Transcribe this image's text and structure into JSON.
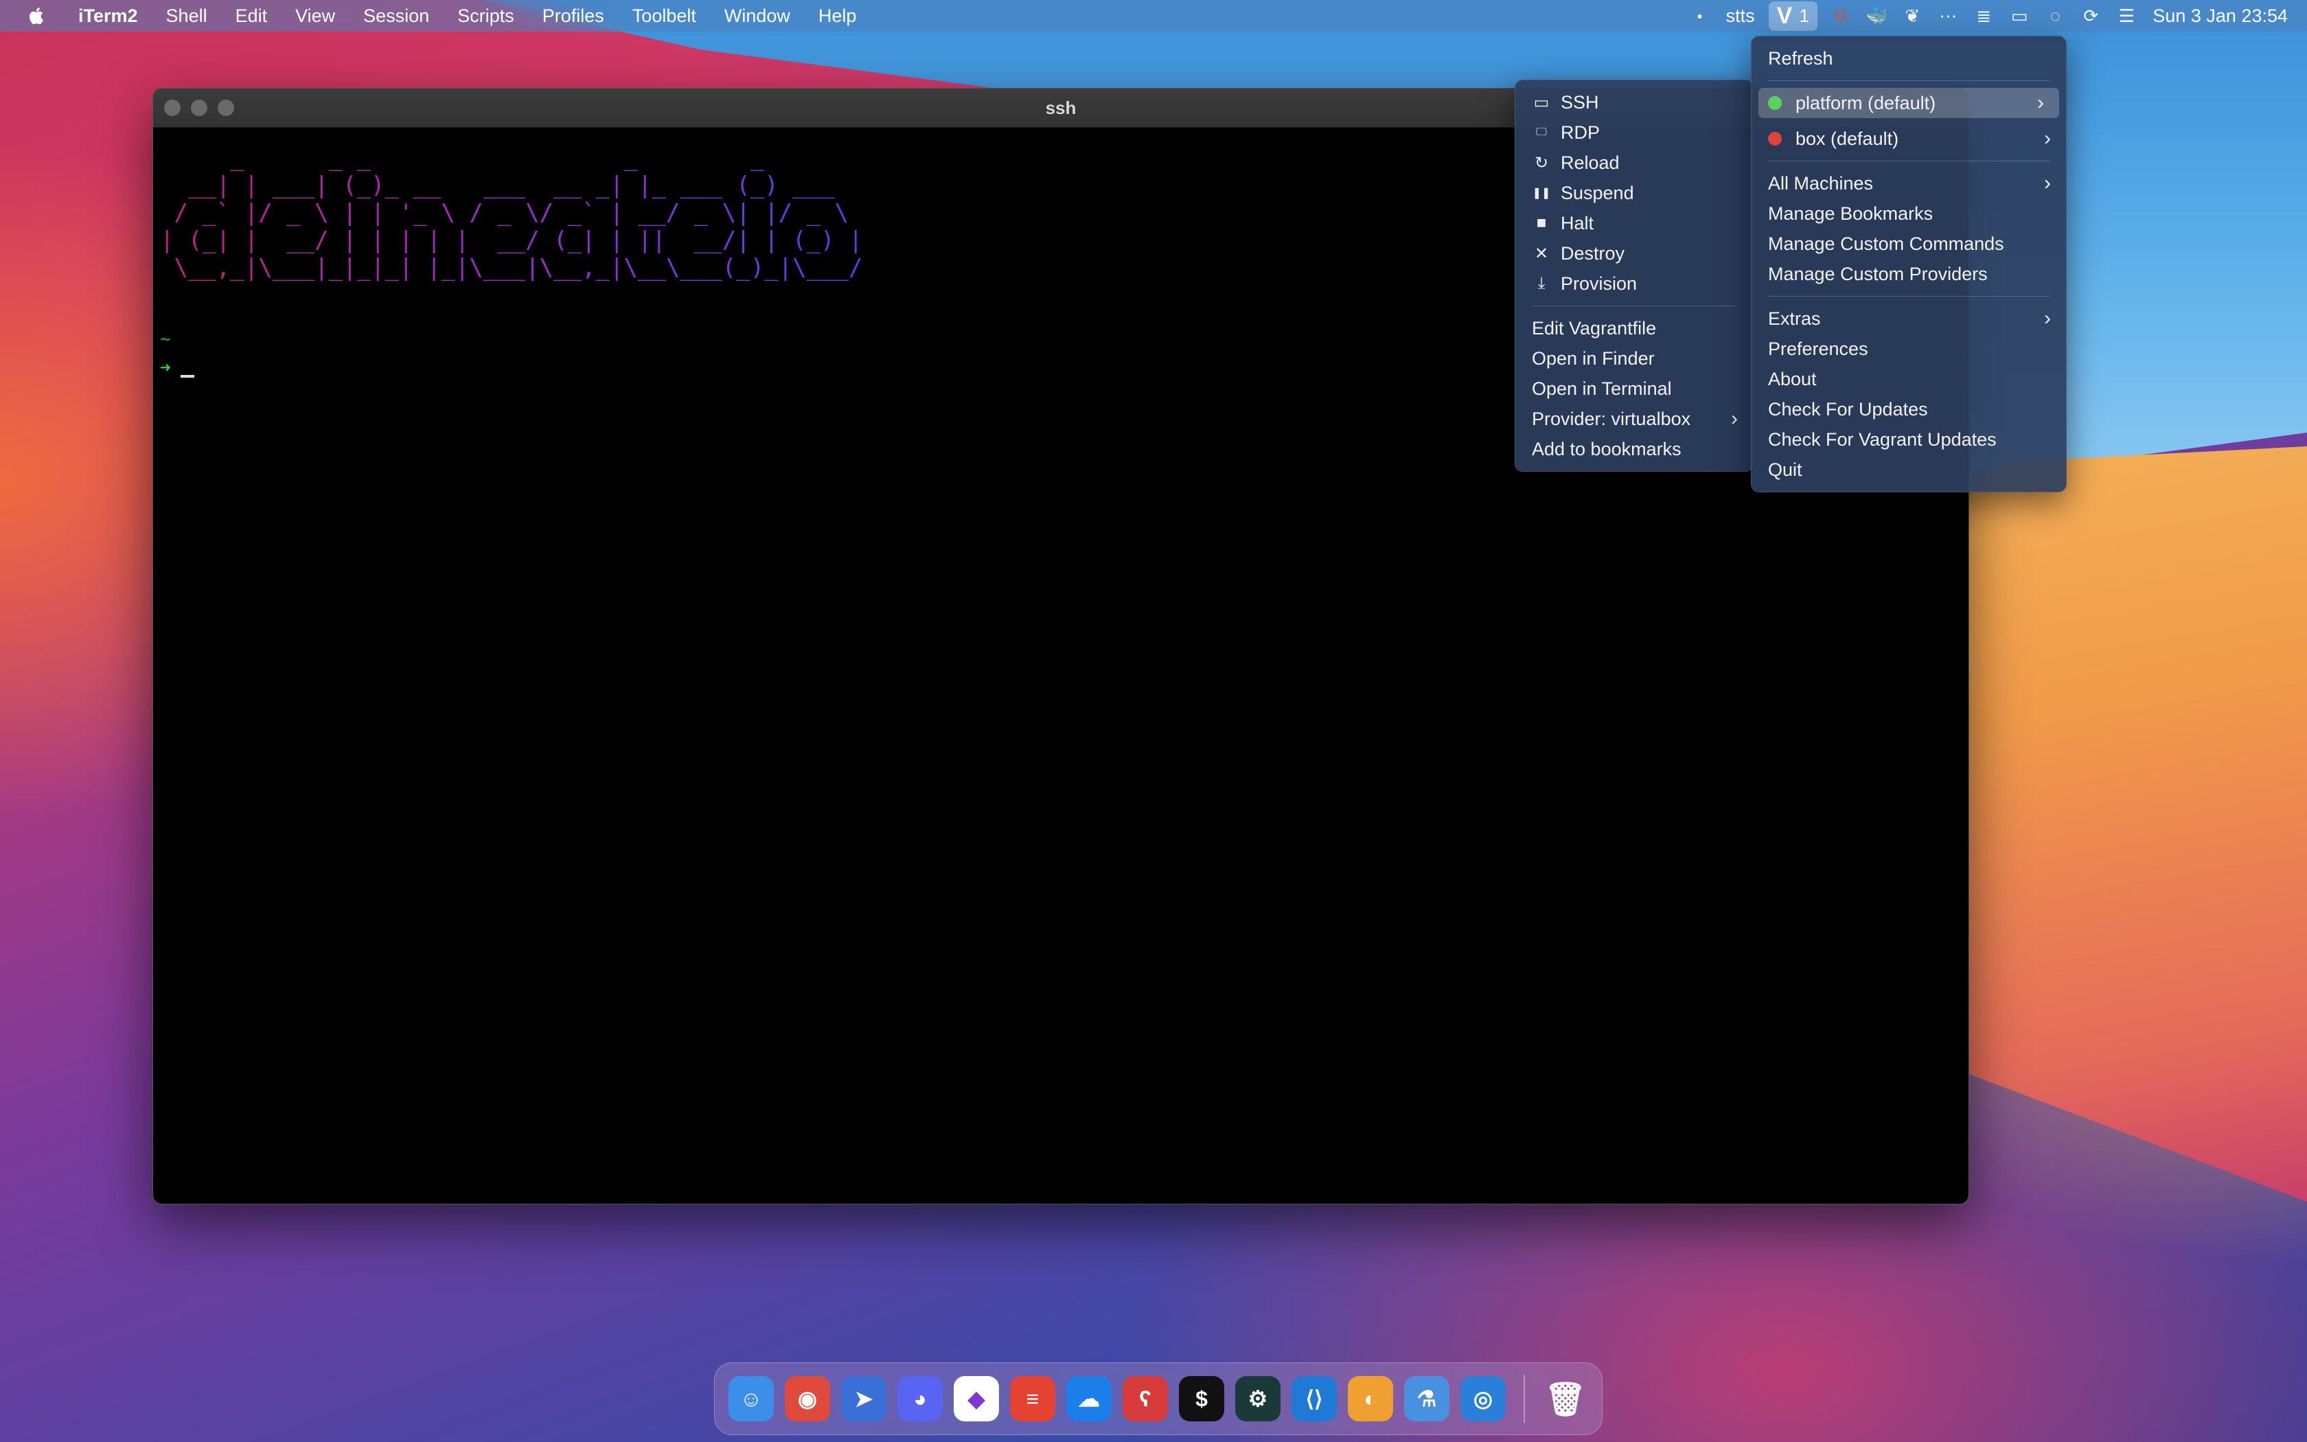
{
  "menubar": {
    "app_name": "iTerm2",
    "items": [
      "Shell",
      "Edit",
      "View",
      "Session",
      "Scripts",
      "Profiles",
      "Toolbelt",
      "Window",
      "Help"
    ],
    "status": {
      "stts_label": "stts",
      "vagrant_badge": "1",
      "clock": "Sun 3 Jan  23:54"
    }
  },
  "terminal": {
    "title": "ssh",
    "ascii_art": [
      "     _      _ _                  _        _       ",
      "  __| | ___| (_)_ __   ___  __ _| |_ ___ (_) ___  ",
      " / _` |/ _ \\ | | '_ \\ / _ \\/ _` | __/ _ \\| |/ _ \\ ",
      "| (_| |  __/ | | | | |  __/ (_| | ||  __/| | (_) |",
      " \\__,_|\\___|_|_|_| |_|\\___|\\__,_|\\__\\___(_)_|\\___/ "
    ],
    "prompt_dir": "~",
    "prompt_arrow": "➜"
  },
  "machine_menu": {
    "actions": [
      {
        "icon": "terminal-icon",
        "glyph": "▭",
        "label": "SSH"
      },
      {
        "icon": "monitor-icon",
        "glyph": "🖵",
        "label": "RDP"
      },
      {
        "icon": "reload-icon",
        "glyph": "↻",
        "label": "Reload"
      },
      {
        "icon": "pause-icon",
        "glyph": "❚❚",
        "label": "Suspend"
      },
      {
        "icon": "stop-icon",
        "glyph": "■",
        "label": "Halt"
      },
      {
        "icon": "x-icon",
        "glyph": "✕",
        "label": "Destroy"
      },
      {
        "icon": "download-icon",
        "glyph": "⤓",
        "label": "Provision"
      }
    ],
    "items": [
      "Edit Vagrantfile",
      "Open in Finder",
      "Open in Terminal"
    ],
    "provider": "Provider: virtualbox",
    "bookmark": "Add to bookmarks"
  },
  "main_menu": {
    "refresh": "Refresh",
    "machines": [
      {
        "label": "platform (default)",
        "status_color": "#5ad35a"
      },
      {
        "label": "box (default)",
        "status_color": "#e0433a"
      }
    ],
    "all_machines": "All Machines",
    "manage": [
      "Manage Bookmarks",
      "Manage Custom Commands",
      "Manage Custom Providers"
    ],
    "extras": "Extras",
    "bottom": [
      "Preferences",
      "About",
      "Check For Updates",
      "Check For Vagrant Updates",
      "Quit"
    ]
  },
  "dock": {
    "apps": [
      {
        "name": "finder",
        "glyph": "☺",
        "color": "#3b8fe8"
      },
      {
        "name": "chrome",
        "glyph": "◉",
        "color": "#e04a3a"
      },
      {
        "name": "spark",
        "glyph": "➤",
        "color": "#3a6fd8"
      },
      {
        "name": "discord",
        "glyph": "◕",
        "color": "#5865f2"
      },
      {
        "name": "affinity",
        "glyph": "◆",
        "color": "#ffffff"
      },
      {
        "name": "todoist",
        "glyph": "≡",
        "color": "#e44332"
      },
      {
        "name": "cloud",
        "glyph": "☁",
        "color": "#1a7fe8"
      },
      {
        "name": "bear",
        "glyph": "ʕ",
        "color": "#d63a3a"
      },
      {
        "name": "iterm",
        "glyph": "$",
        "color": "#111111"
      },
      {
        "name": "gitkraken",
        "glyph": "⚙",
        "color": "#1a3a3a"
      },
      {
        "name": "vscode",
        "glyph": "⟨⟩",
        "color": "#1f7ad6"
      },
      {
        "name": "sequel",
        "glyph": "◐",
        "color": "#f0a030"
      },
      {
        "name": "xcode-tools",
        "glyph": "⚗",
        "color": "#4a90e0"
      },
      {
        "name": "proxyman",
        "glyph": "◎",
        "color": "#2a7fd8"
      }
    ],
    "trash": {
      "name": "trash",
      "glyph": "🗑",
      "color": "#8a8a8a"
    }
  }
}
